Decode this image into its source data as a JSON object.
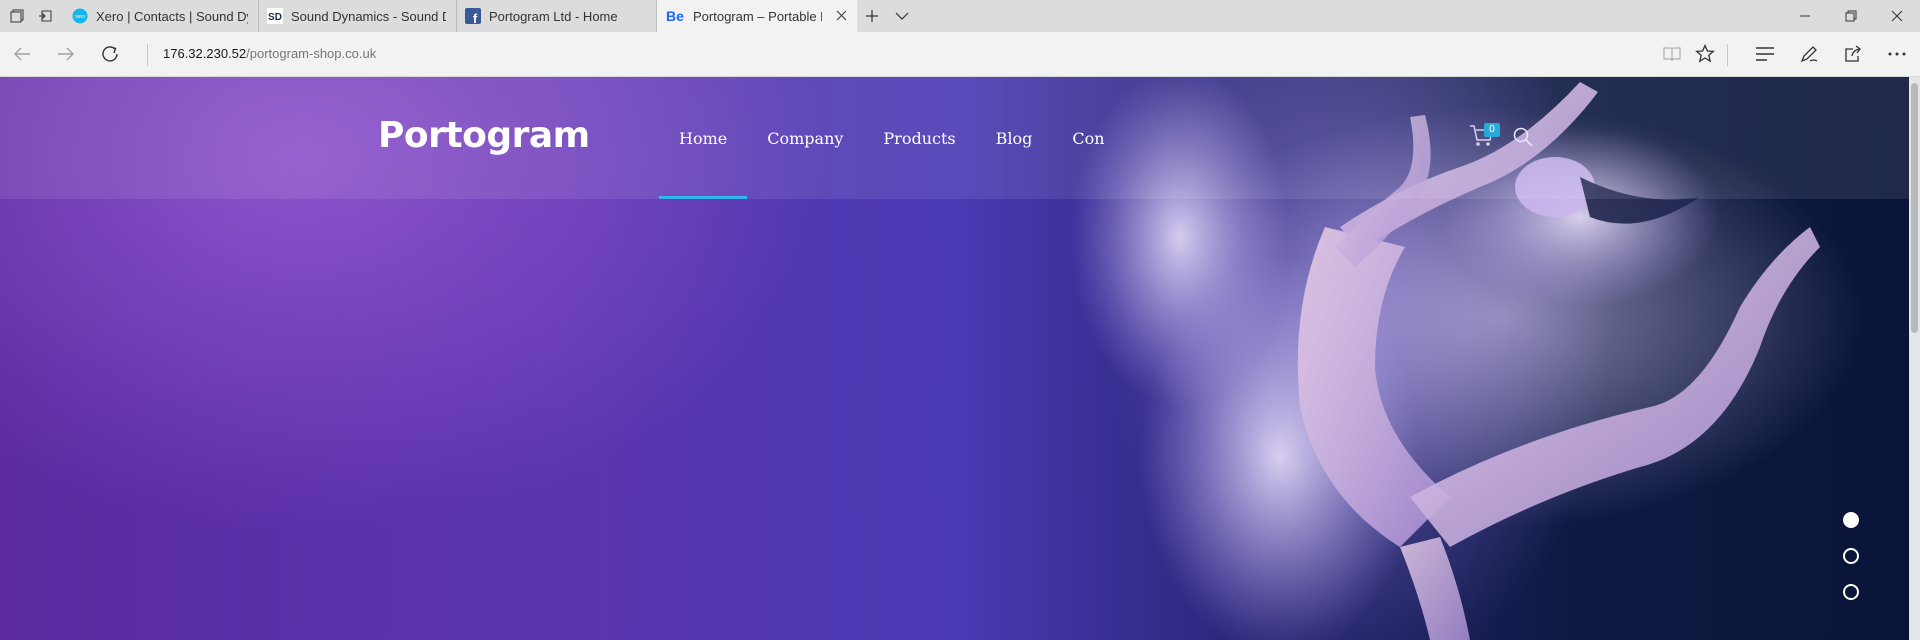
{
  "browser": {
    "tabs": [
      {
        "title": "Xero | Contacts | Sound Dyr",
        "favicon": "xero-icon",
        "active": false
      },
      {
        "title": "Sound Dynamics - Sound D",
        "favicon": "sound-dynamics-icon",
        "active": false
      },
      {
        "title": "Portogram Ltd - Home",
        "favicon": "facebook-icon",
        "active": false
      },
      {
        "title": "Portogram – Portable D",
        "favicon": "behance-icon",
        "active": true
      }
    ],
    "favicon_text": {
      "xero": "xero",
      "sd": "SD",
      "fb": "f",
      "be": "Be"
    },
    "address": {
      "host": "176.32.230.52",
      "path": "/portogram-shop.co.uk"
    },
    "colors": {
      "tabbar": "#dcdcdc",
      "active_tab": "#f2f2f2",
      "behance": "#1769ff",
      "facebook": "#3b5998",
      "xero": "#13b5ea"
    }
  },
  "site": {
    "logo": "Portogram",
    "menu": [
      {
        "label": "Home",
        "active": true
      },
      {
        "label": "Company",
        "active": false
      },
      {
        "label": "Products",
        "active": false
      },
      {
        "label": "Blog",
        "active": false
      },
      {
        "label": "Con",
        "active": false
      }
    ],
    "cart_count": "0",
    "slider": {
      "count": 3,
      "active_index": 0
    },
    "colors": {
      "accent": "#30b6e8",
      "badge": "#2aa8d8"
    }
  }
}
